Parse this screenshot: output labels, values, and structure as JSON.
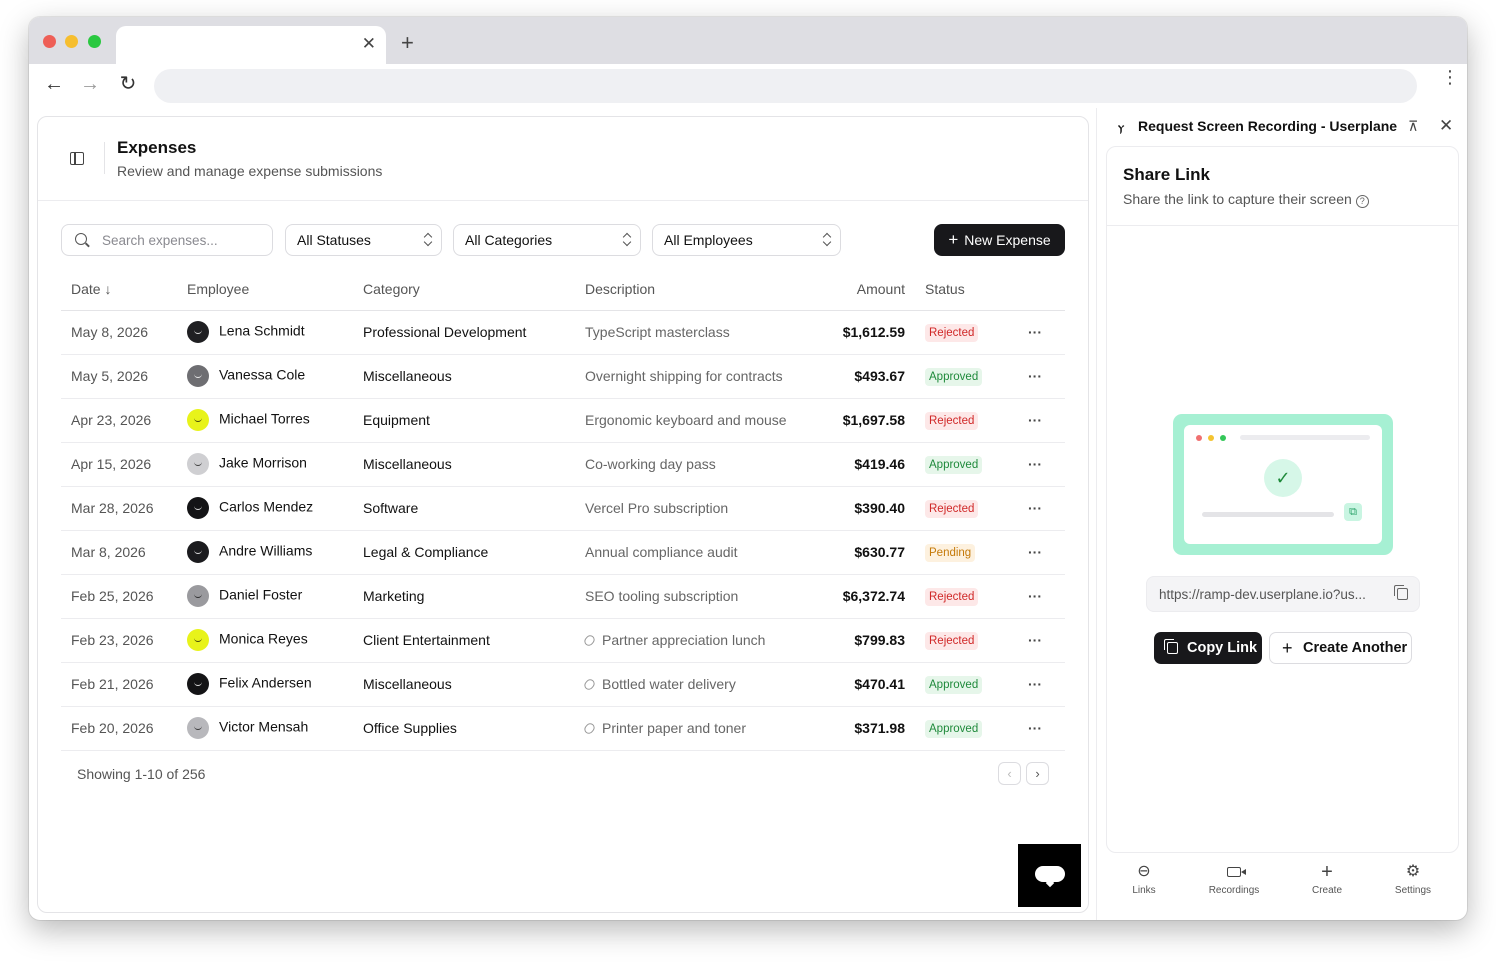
{
  "browser": {
    "tab_close": "✕",
    "new_tab": "+",
    "back": "←",
    "forward": "→",
    "reload": "↻",
    "menu": "⋮"
  },
  "header": {
    "title": "Expenses",
    "subtitle": "Review and manage expense submissions"
  },
  "filters": {
    "search_placeholder": "Search expenses...",
    "status": "All Statuses",
    "category": "All Categories",
    "employee": "All Employees",
    "new_expense": "New Expense"
  },
  "table": {
    "columns": {
      "date": "Date ↓",
      "employee": "Employee",
      "category": "Category",
      "description": "Description",
      "amount": "Amount",
      "status": "Status"
    },
    "rows": [
      {
        "date": "May 8, 2026",
        "employee": "Lena Schmidt",
        "avatar_color": "#1f1f22",
        "category": "Professional Development",
        "description": "TypeScript masterclass",
        "attachment": false,
        "amount": "$1,612.59",
        "status": "Rejected",
        "actions": "···"
      },
      {
        "date": "May 5, 2026",
        "employee": "Vanessa Cole",
        "avatar_color": "#6e6e72",
        "category": "Miscellaneous",
        "description": "Overnight shipping for contracts",
        "attachment": false,
        "amount": "$493.67",
        "status": "Approved",
        "actions": "···"
      },
      {
        "date": "Apr 23, 2026",
        "employee": "Michael Torres",
        "avatar_color": "#e8f31a",
        "category": "Equipment",
        "description": "Ergonomic keyboard and mouse",
        "attachment": false,
        "amount": "$1,697.58",
        "status": "Rejected",
        "actions": "···"
      },
      {
        "date": "Apr 15, 2026",
        "employee": "Jake Morrison",
        "avatar_color": "#cfcfd2",
        "category": "Miscellaneous",
        "description": "Co-working day pass",
        "attachment": false,
        "amount": "$419.46",
        "status": "Approved",
        "actions": "···"
      },
      {
        "date": "Mar 28, 2026",
        "employee": "Carlos Mendez",
        "avatar_color": "#141416",
        "category": "Software",
        "description": "Vercel Pro subscription",
        "attachment": false,
        "amount": "$390.40",
        "status": "Rejected",
        "actions": "···"
      },
      {
        "date": "Mar 8, 2026",
        "employee": "Andre Williams",
        "avatar_color": "#1b1b1e",
        "category": "Legal & Compliance",
        "description": "Annual compliance audit",
        "attachment": false,
        "amount": "$630.77",
        "status": "Pending",
        "actions": "···"
      },
      {
        "date": "Feb 25, 2026",
        "employee": "Daniel Foster",
        "avatar_color": "#9a9a9e",
        "category": "Marketing",
        "description": "SEO tooling subscription",
        "attachment": false,
        "amount": "$6,372.74",
        "status": "Rejected",
        "actions": "···"
      },
      {
        "date": "Feb 23, 2026",
        "employee": "Monica Reyes",
        "avatar_color": "#e8f31a",
        "category": "Client Entertainment",
        "description": "Partner appreciation lunch",
        "attachment": true,
        "amount": "$799.83",
        "status": "Rejected",
        "actions": "···"
      },
      {
        "date": "Feb 21, 2026",
        "employee": "Felix Andersen",
        "avatar_color": "#141416",
        "category": "Miscellaneous",
        "description": "Bottled water delivery",
        "attachment": true,
        "amount": "$470.41",
        "status": "Approved",
        "actions": "···"
      },
      {
        "date": "Feb 20, 2026",
        "employee": "Victor Mensah",
        "avatar_color": "#b8b8bc",
        "category": "Office Supplies",
        "description": "Printer paper and toner",
        "attachment": true,
        "amount": "$371.98",
        "status": "Approved",
        "actions": "···"
      }
    ]
  },
  "pagination": {
    "showing": "Showing 1-10 of 256",
    "prev": "‹",
    "next": "›"
  },
  "side_panel": {
    "logo": "ⲩ",
    "title": "Request Screen Recording - Userplane",
    "pin": "⊼",
    "close": "✕",
    "share_title": "Share Link",
    "share_subtitle": "Share the link to capture their screen",
    "help": "?",
    "link_url": "https://ramp-dev.userplane.io?us...",
    "copy_link": "Copy Link",
    "create_another": "Create Another",
    "check": "✓",
    "illus_copy": "⧉"
  },
  "bottom_nav": [
    {
      "label": "Links",
      "icon": "link-icon",
      "glyph": "⊖"
    },
    {
      "label": "Recordings",
      "icon": "video-icon",
      "glyph": ""
    },
    {
      "label": "Create",
      "icon": "plus-icon",
      "glyph": "+"
    },
    {
      "label": "Settings",
      "icon": "gear-icon",
      "glyph": "⚙"
    }
  ],
  "colors": {
    "primary_button": "#18181b",
    "rejected": "#d02828",
    "approved": "#1f8a3b",
    "pending": "#c57a0a",
    "illustration": "#a6f0d3"
  }
}
